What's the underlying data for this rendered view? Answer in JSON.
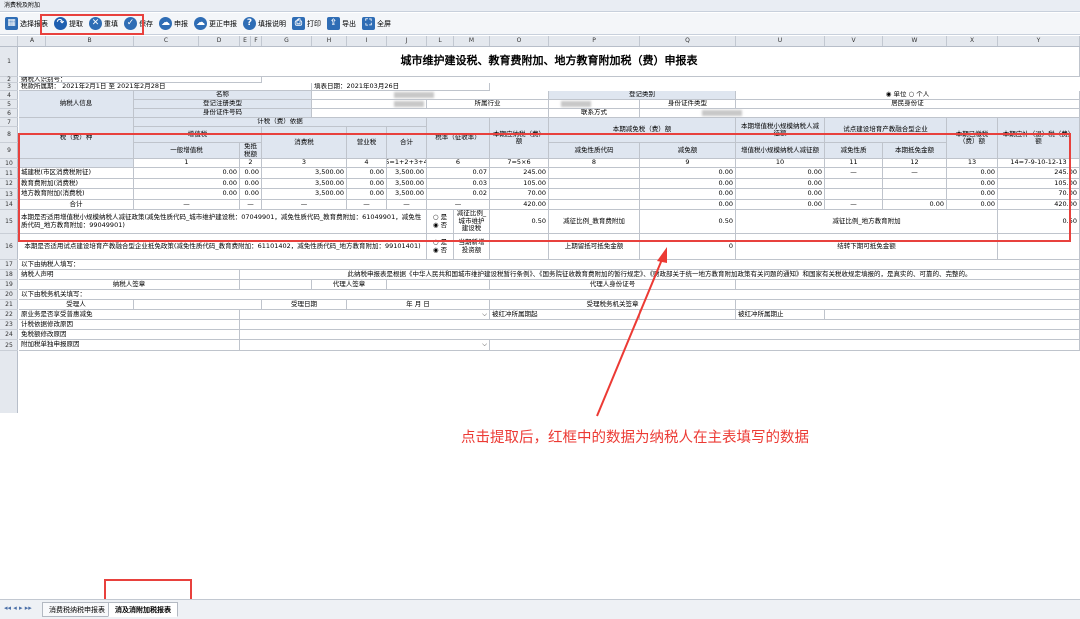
{
  "window": {
    "title": "消费税及附加"
  },
  "toolbar": {
    "items": [
      {
        "label": "选择报表",
        "icon": "grid-icon",
        "color": "#2f6db5"
      },
      {
        "label": "提取",
        "icon": "redo-arrow-icon",
        "color": "#1f5fb0"
      },
      {
        "label": "重填",
        "icon": "clear-x-icon",
        "color": "#2f6db5"
      },
      {
        "label": "保存",
        "icon": "check-icon",
        "color": "#2f6db5"
      },
      {
        "label": "申报",
        "icon": "cloud-upload-icon",
        "color": "#2f6db5"
      },
      {
        "label": "更正申报",
        "icon": "cloud-refresh-icon",
        "color": "#2f6db5"
      },
      {
        "label": "填报说明",
        "icon": "help-icon",
        "color": "#2f6db5"
      },
      {
        "label": "打印",
        "icon": "printer-icon",
        "color": "#2f6db5"
      },
      {
        "label": "导出",
        "icon": "export-icon",
        "color": "#2f6db5"
      },
      {
        "label": "全屏",
        "icon": "fullscreen-icon",
        "color": "#2f6db5"
      }
    ]
  },
  "columns": [
    "A",
    "B",
    "C",
    "D",
    "E",
    "F",
    "G",
    "H",
    "I",
    "J",
    "L",
    "M",
    "O",
    "P",
    "Q",
    "U",
    "V",
    "W",
    "X",
    "Y"
  ],
  "rows": [
    "1",
    "2",
    "3",
    "4",
    "5",
    "6",
    "7",
    "8",
    "9",
    "10",
    "11",
    "12",
    "13",
    "14",
    "15",
    "16",
    "17",
    "18",
    "19",
    "20",
    "21",
    "22",
    "23",
    "24",
    "25"
  ],
  "form": {
    "title": "城市维护建设税、教育费附加、地方教育附加税（费）申报表",
    "taxpayer_id_label": "纳税人识别号：",
    "period_label": "税款所属期：  2021年2月1日  至  2021年2月28日",
    "fill_date": "填表日期：2021年03月26日",
    "info_label": "纳税人信息",
    "name_label": "名称",
    "reg_type_label": "登记注册类型",
    "id_type_label": "身份证件号码",
    "reg_class_label": "登记类别",
    "industry_label": "所属行业",
    "idcard_type_label": "身份证件类型",
    "contact_label": "联系方式",
    "unit_option": "◉ 单位 ○ 个人",
    "resident_id": "居民身份证",
    "tax_type_label": "税（费）种",
    "basis_label": "计税（费）依据",
    "vat_label": "增值税",
    "general_vat": "一般增值税",
    "exempt_tax": "免抵税额",
    "consumption_tax": "消费税",
    "business_tax": "营业税",
    "total_label": "合计",
    "rate_label": "税率（征收率）",
    "payable_label": "本期应纳税（费）额",
    "reduce_label": "本期减免税（费）额",
    "reduce_code": "减免性质代码",
    "reduce_amount": "减免额",
    "small_vat_label": "本期增值税小规模纳税人减征额",
    "small_vat_sub": "增值税小规模纳税人减征额",
    "pilot_label": "试点建设培育产教融合型企业",
    "reduce_nature": "减免性质",
    "pilot_amount": "本期抵免金额",
    "paid_label": "本期已缴税（费）额",
    "refund_label": "本期应补（退）税（费）额",
    "col_numbers": [
      "1",
      "2",
      "3",
      "4",
      "5=1+2+3+4",
      "6",
      "7=5×6",
      "8",
      "9",
      "10",
      "11",
      "12",
      "13",
      "14=7-9-10-12-13"
    ],
    "data_rows": [
      {
        "name": "城建税(市区消费税附征)",
        "c1": "0.00",
        "c2": "0.00",
        "c3": "3,500.00",
        "c4": "0.00",
        "c5": "3,500.00",
        "c6": "0.07",
        "c7": "245.00",
        "c8": "",
        "c9": "0.00",
        "c10": "0.00",
        "c11": "—",
        "c12": "—",
        "c13": "0.00",
        "c14": "245.00"
      },
      {
        "name": "教育费附加(消费税)",
        "c1": "0.00",
        "c2": "0.00",
        "c3": "3,500.00",
        "c4": "0.00",
        "c5": "3,500.00",
        "c6": "0.03",
        "c7": "105.00",
        "c8": "",
        "c9": "0.00",
        "c10": "0.00",
        "c11": "",
        "c12": "",
        "c13": "0.00",
        "c14": "105.00"
      },
      {
        "name": "地方教育附加(消费税)",
        "c1": "0.00",
        "c2": "0.00",
        "c3": "3,500.00",
        "c4": "0.00",
        "c5": "3,500.00",
        "c6": "0.02",
        "c7": "70.00",
        "c8": "",
        "c9": "0.00",
        "c10": "0.00",
        "c11": "",
        "c12": "",
        "c13": "0.00",
        "c14": "70.00"
      },
      {
        "name": "合计",
        "c1": "—",
        "c2": "—",
        "c3": "—",
        "c4": "—",
        "c5": "—",
        "c6": "—",
        "c7": "420.00",
        "c8": "",
        "c9": "0.00",
        "c10": "0.00",
        "c11": "—",
        "c12": "0.00",
        "c13": "0.00",
        "c14": "420.00"
      }
    ],
    "r15_text": "本期是否适用增值税小规模纳税人减征政策(减免性质代码_城市维护建设税：07049901，减免性质代码_教育费附加：61049901，减免性质代码_地方教育附加：99049901)",
    "yes": "○ 是",
    "no": "◉ 否",
    "r15_ratio1": "减征比例_城市维护建设税",
    "r15_val1": "0.50",
    "r15_ratio2": "减征比例_教育费附加",
    "r15_val2": "0.50",
    "r15_ratio3": "减征比例_地方教育附加",
    "r15_val3": "0.50",
    "r16_text": "本期是否适用试点建设培育产教融合型企业抵免政策(减免性质代码_教育费附加：61101402，减免性质代码_地方教育附加：99101401)",
    "r16_invest": "当期新增投资额",
    "r16_prev": "上期留抵可抵免金额",
    "r16_prev_val": "0",
    "r16_next": "结转下期可抵免金额",
    "r17": "以下由纳税人填写：",
    "r18_label": "纳税人声明",
    "r18_text": "此纳税申报表是根据《中华人民共和国城市维护建设税暂行条例》、《国务院征收教育费附加的暂行规定》、《财政部关于统一地方教育附加政策有关问题的通知》和国家有关税收规定填报的，是真实的、可靠的、完整的。",
    "r19_sign": "纳税人签章",
    "r19_agent": "代理人签章",
    "r19_agent_id": "代理人身份证号",
    "r20": "以下由税务机关填写：",
    "r21_receiver": "受理人",
    "r21_date": "受理日期",
    "r21_ymd": "年    月    日",
    "r21_office": "受理税务机关签章",
    "r22_label": "原业务是否享受普惠减免",
    "r22_red_start": "被红冲所属期起",
    "r22_red_end": "被红冲所属期止",
    "r23": "计税依据修改原因",
    "r24": "免税额修改原因",
    "r25": "附加税单独申报原因"
  },
  "sheet_tabs": [
    {
      "label": "消费税纳税申报表"
    },
    {
      "label": "消及消附加税报表"
    }
  ],
  "annotation": {
    "text": "点击提取后，红框中的数据为纳税人在主表填写的数据",
    "color": "#ec3a34"
  }
}
